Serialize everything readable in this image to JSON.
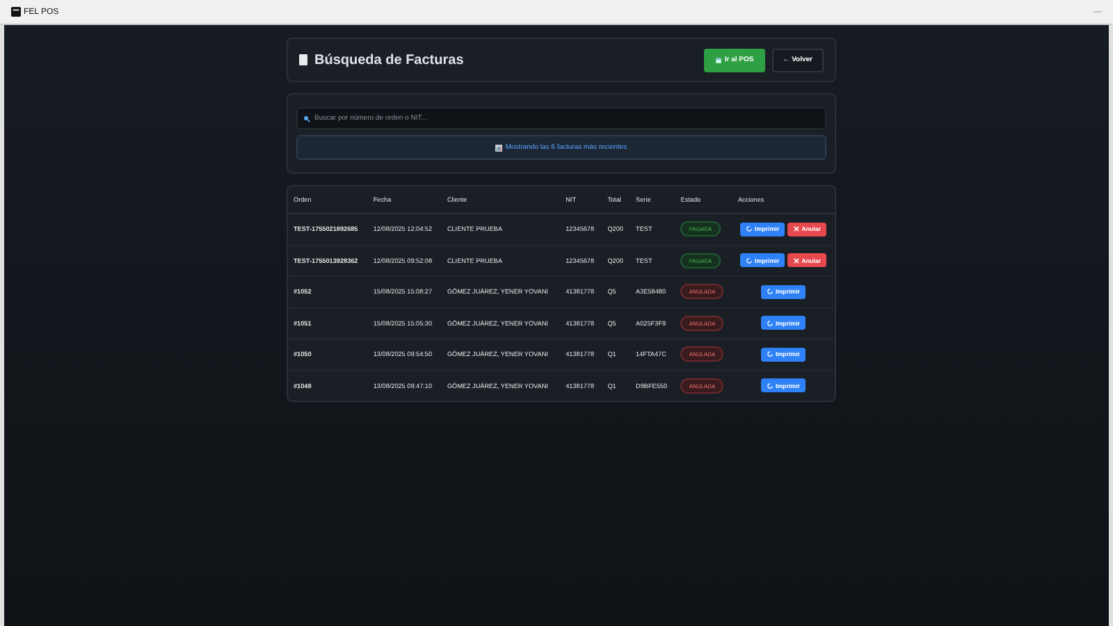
{
  "window": {
    "title": "FEL POS",
    "controls": [
      "—"
    ]
  },
  "header": {
    "title": "Búsqueda de Facturas",
    "buttons": [
      {
        "label": "Ir al POS",
        "kind": "primary"
      },
      {
        "label": "← Volver",
        "kind": "secondary"
      }
    ]
  },
  "search": {
    "placeholder": "Buscar por número de orden o NIT...",
    "info": "Mostrando las 6 facturas más recientes"
  },
  "table": {
    "columns": [
      "Orden",
      "Fecha",
      "Cliente",
      "NIT",
      "Total",
      "Serie",
      "Estado",
      "Acciones"
    ],
    "rows": [
      {
        "orden": "TEST-1755021892685",
        "fecha": "12/08/2025 12:04:52",
        "cliente": "CLIENTE PRUEBA",
        "nit": "12345678",
        "total": "Q200",
        "serie": "TEST",
        "estado": {
          "label": "PAGADA",
          "kind": "paid"
        },
        "actions": [
          {
            "label": "Imprimir",
            "kind": "print"
          },
          {
            "label": "Anular",
            "kind": "void"
          }
        ]
      },
      {
        "orden": "TEST-1755013928362",
        "fecha": "12/08/2025 09:52:08",
        "cliente": "CLIENTE PRUEBA",
        "nit": "12345678",
        "total": "Q200",
        "serie": "TEST",
        "estado": {
          "label": "PAGADA",
          "kind": "paid"
        },
        "actions": [
          {
            "label": "Imprimir",
            "kind": "print"
          },
          {
            "label": "Anular",
            "kind": "void"
          }
        ]
      },
      {
        "orden": "#1052",
        "fecha": "15/08/2025 15:08:27",
        "cliente": "GÓMEZ JUÁREZ, YENER YOVANI",
        "nit": "41381778",
        "total": "Q5",
        "serie": "A3E58480",
        "estado": {
          "label": "ANULADA",
          "kind": "void"
        },
        "actions": [
          {
            "label": "Imprimir",
            "kind": "print"
          }
        ]
      },
      {
        "orden": "#1051",
        "fecha": "15/08/2025 15:05:30",
        "cliente": "GÓMEZ JUÁREZ, YENER YOVANI",
        "nit": "41381778",
        "total": "Q5",
        "serie": "A025F3F9",
        "estado": {
          "label": "ANULADA",
          "kind": "void"
        },
        "actions": [
          {
            "label": "Imprimir",
            "kind": "print"
          }
        ]
      },
      {
        "orden": "#1050",
        "fecha": "13/08/2025 09:54:50",
        "cliente": "GÓMEZ JUÁREZ, YENER YOVANI",
        "nit": "41381778",
        "total": "Q1",
        "serie": "14FTA47C",
        "estado": {
          "label": "ANULADA",
          "kind": "void"
        },
        "actions": [
          {
            "label": "Imprimir",
            "kind": "print"
          }
        ]
      },
      {
        "orden": "#1049",
        "fecha": "13/08/2025 09:47:10",
        "cliente": "GÓMEZ JUÁREZ, YENER YOVANI",
        "nit": "41381778",
        "total": "Q1",
        "serie": "D9BFE550",
        "estado": {
          "label": "ANULADA",
          "kind": "void"
        },
        "actions": [
          {
            "label": "Imprimir",
            "kind": "print"
          }
        ]
      }
    ]
  }
}
